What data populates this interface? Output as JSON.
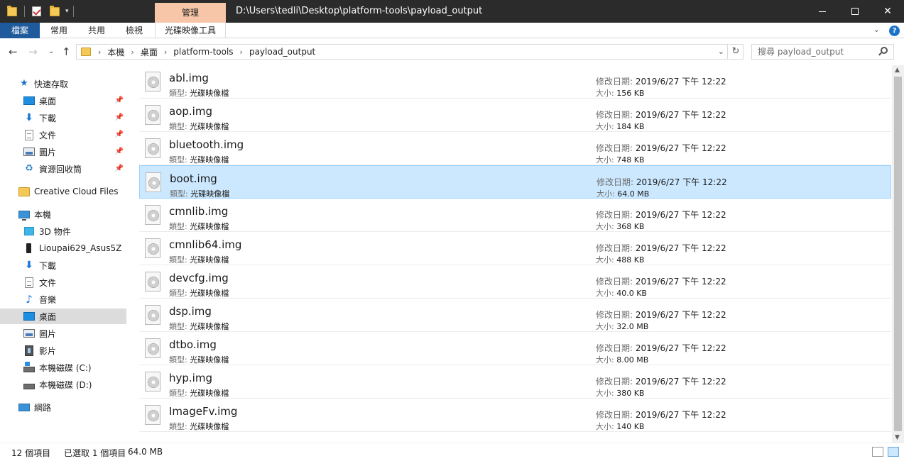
{
  "window": {
    "title": "D:\\Users\\tedli\\Desktop\\platform-tools\\payload_output",
    "context_tab": "管理"
  },
  "ribbon": {
    "tabs": [
      {
        "label": "檔案"
      },
      {
        "label": "常用"
      },
      {
        "label": "共用"
      },
      {
        "label": "檢視"
      },
      {
        "label": "光碟映像工具"
      }
    ]
  },
  "address": {
    "breadcrumbs": [
      "本機",
      "桌面",
      "platform-tools",
      "payload_output"
    ],
    "search_placeholder": "搜尋 payload_output"
  },
  "nav": {
    "quick_access": "快速存取",
    "quick_items": [
      {
        "label": "桌面",
        "icon": "desktop-icon"
      },
      {
        "label": "下載",
        "icon": "download-icon"
      },
      {
        "label": "文件",
        "icon": "document-icon"
      },
      {
        "label": "圖片",
        "icon": "picture-icon"
      },
      {
        "label": "資源回收筒",
        "icon": "recycle-bin-icon"
      }
    ],
    "creative_cloud": "Creative Cloud Files",
    "this_pc": "本機",
    "pc_items": [
      {
        "label": "3D 物件",
        "icon": "3d-objects-icon"
      },
      {
        "label": "Lioupai629_Asus5Z",
        "icon": "phone-icon"
      },
      {
        "label": "下載",
        "icon": "download-icon"
      },
      {
        "label": "文件",
        "icon": "document-icon"
      },
      {
        "label": "音樂",
        "icon": "music-icon"
      },
      {
        "label": "桌面",
        "icon": "desktop-icon"
      },
      {
        "label": "圖片",
        "icon": "picture-icon"
      },
      {
        "label": "影片",
        "icon": "video-icon"
      },
      {
        "label": "本機磁碟 (C:)",
        "icon": "drive-c-icon"
      },
      {
        "label": "本機磁碟 (D:)",
        "icon": "drive-d-icon"
      }
    ],
    "network": "網路"
  },
  "files": {
    "type_label": "類型:",
    "date_label": "修改日期:",
    "size_label": "大小:",
    "items": [
      {
        "name": "abl.img",
        "type": "光碟映像檔",
        "date": "2019/6/27 下午 12:22",
        "size": "156 KB"
      },
      {
        "name": "aop.img",
        "type": "光碟映像檔",
        "date": "2019/6/27 下午 12:22",
        "size": "184 KB"
      },
      {
        "name": "bluetooth.img",
        "type": "光碟映像檔",
        "date": "2019/6/27 下午 12:22",
        "size": "748 KB"
      },
      {
        "name": "boot.img",
        "type": "光碟映像檔",
        "date": "2019/6/27 下午 12:22",
        "size": "64.0 MB",
        "selected": true
      },
      {
        "name": "cmnlib.img",
        "type": "光碟映像檔",
        "date": "2019/6/27 下午 12:22",
        "size": "368 KB"
      },
      {
        "name": "cmnlib64.img",
        "type": "光碟映像檔",
        "date": "2019/6/27 下午 12:22",
        "size": "488 KB"
      },
      {
        "name": "devcfg.img",
        "type": "光碟映像檔",
        "date": "2019/6/27 下午 12:22",
        "size": "40.0 KB"
      },
      {
        "name": "dsp.img",
        "type": "光碟映像檔",
        "date": "2019/6/27 下午 12:22",
        "size": "32.0 MB"
      },
      {
        "name": "dtbo.img",
        "type": "光碟映像檔",
        "date": "2019/6/27 下午 12:22",
        "size": "8.00 MB"
      },
      {
        "name": "hyp.img",
        "type": "光碟映像檔",
        "date": "2019/6/27 下午 12:22",
        "size": "380 KB"
      },
      {
        "name": "ImageFv.img",
        "type": "光碟映像檔",
        "date": "2019/6/27 下午 12:22",
        "size": "140 KB"
      }
    ]
  },
  "status": {
    "count": "12 個項目",
    "selected": "已選取 1 個項目",
    "selected_size": "64.0 MB"
  }
}
